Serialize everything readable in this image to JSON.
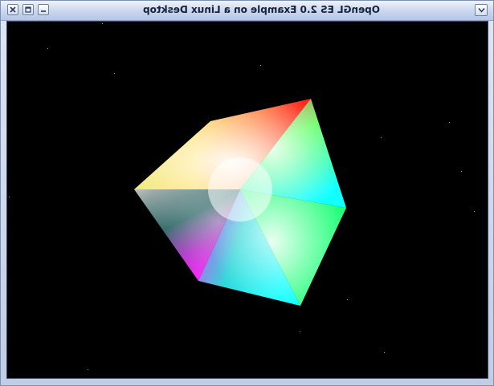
{
  "window": {
    "title": "OpenGL ES 2.0 Example on a Linux Desktop"
  },
  "titlebar_buttons": [
    {
      "name": "close",
      "icon": "close-icon"
    },
    {
      "name": "maximize",
      "icon": "maximize-icon"
    },
    {
      "name": "minimize",
      "icon": "minimize-icon"
    },
    {
      "name": "window-menu",
      "icon": "chevron-down-icon"
    }
  ],
  "scene": {
    "background": "#000000",
    "object": "rotating RGB color cube",
    "vertex_colors": {
      "top_right": "#ff1a1a",
      "top_left": "#ffff22",
      "right": "#22ff22",
      "bottom_right": "#00ffff",
      "bottom_left": "#ff22ff",
      "left": "#bfbfbf",
      "center": "#ffffff"
    }
  }
}
